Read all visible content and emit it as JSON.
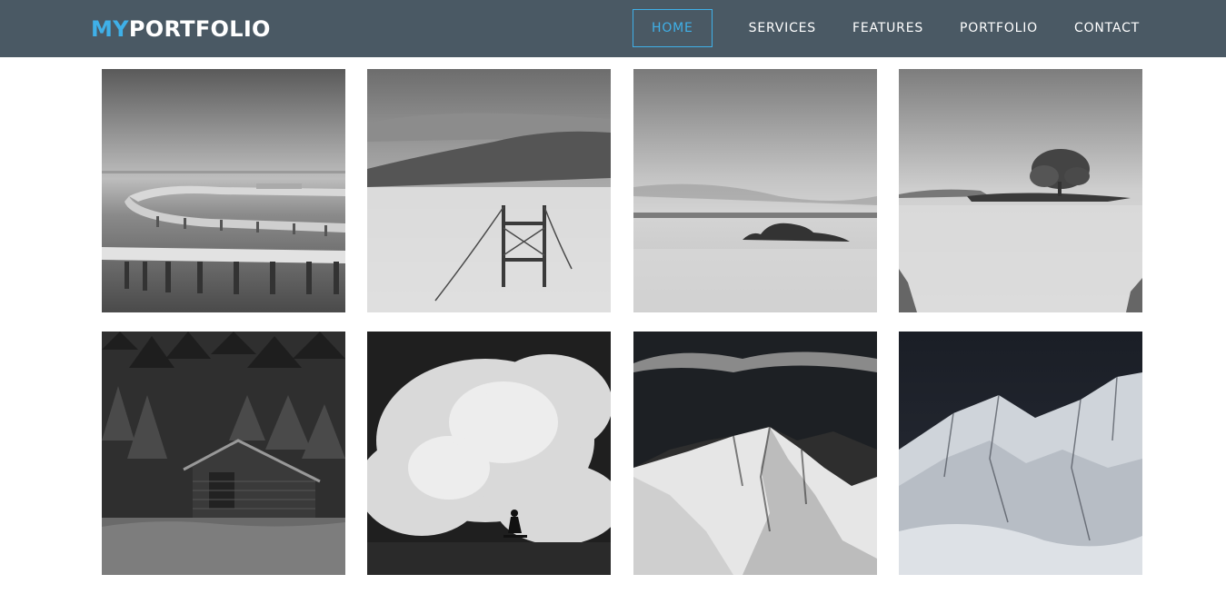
{
  "brand": {
    "part1": "MY",
    "part2": "PORTFOLIO"
  },
  "nav": {
    "items": [
      {
        "label": "HOME",
        "active": true
      },
      {
        "label": "SERVICES",
        "active": false
      },
      {
        "label": "FEATURES",
        "active": false
      },
      {
        "label": "PORTFOLIO",
        "active": false
      },
      {
        "label": "CONTACT",
        "active": false
      }
    ]
  },
  "colors": {
    "navbar_bg": "#4a5964",
    "accent": "#3fb0e8",
    "page_bg": "#ffffff"
  },
  "gallery": {
    "items": [
      {
        "subject": "pier-over-water"
      },
      {
        "subject": "bridge-in-fog"
      },
      {
        "subject": "rock-in-calm-sea"
      },
      {
        "subject": "tree-island-lake"
      },
      {
        "subject": "cabin-in-forest"
      },
      {
        "subject": "surfer-in-wave"
      },
      {
        "subject": "snowy-mountain-peaks"
      },
      {
        "subject": "snowy-mountain-slope"
      }
    ]
  }
}
